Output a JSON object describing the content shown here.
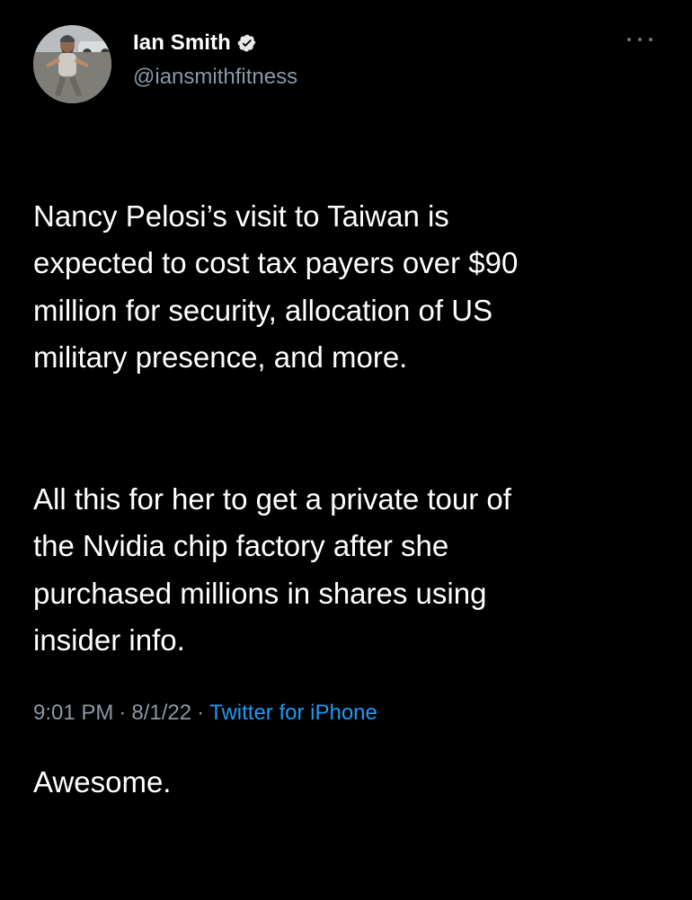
{
  "author": {
    "display_name": "Ian Smith",
    "handle": "@iansmithfitness",
    "verified": true
  },
  "tweet": {
    "paragraphs": [
      "Nancy Pelosi’s visit to Taiwan is\nexpected to cost tax payers over $90\nmillion for security, allocation of US\nmilitary presence, and more.",
      "All this for her to get a private tour of\nthe Nvidia chip factory after she\npurchased millions in shares using\ninsider info.",
      "Awesome."
    ],
    "time": "9:01 PM",
    "date": "8/1/22",
    "separator": "·",
    "source": "Twitter for iPhone"
  },
  "icons": {
    "verified": "verified-badge-icon",
    "more": "more-options-icon"
  },
  "colors": {
    "background": "#000000",
    "text": "#ffffff",
    "secondary": "#8b98a5",
    "link": "#1d9bf0",
    "verified": "#e7e9ea"
  }
}
